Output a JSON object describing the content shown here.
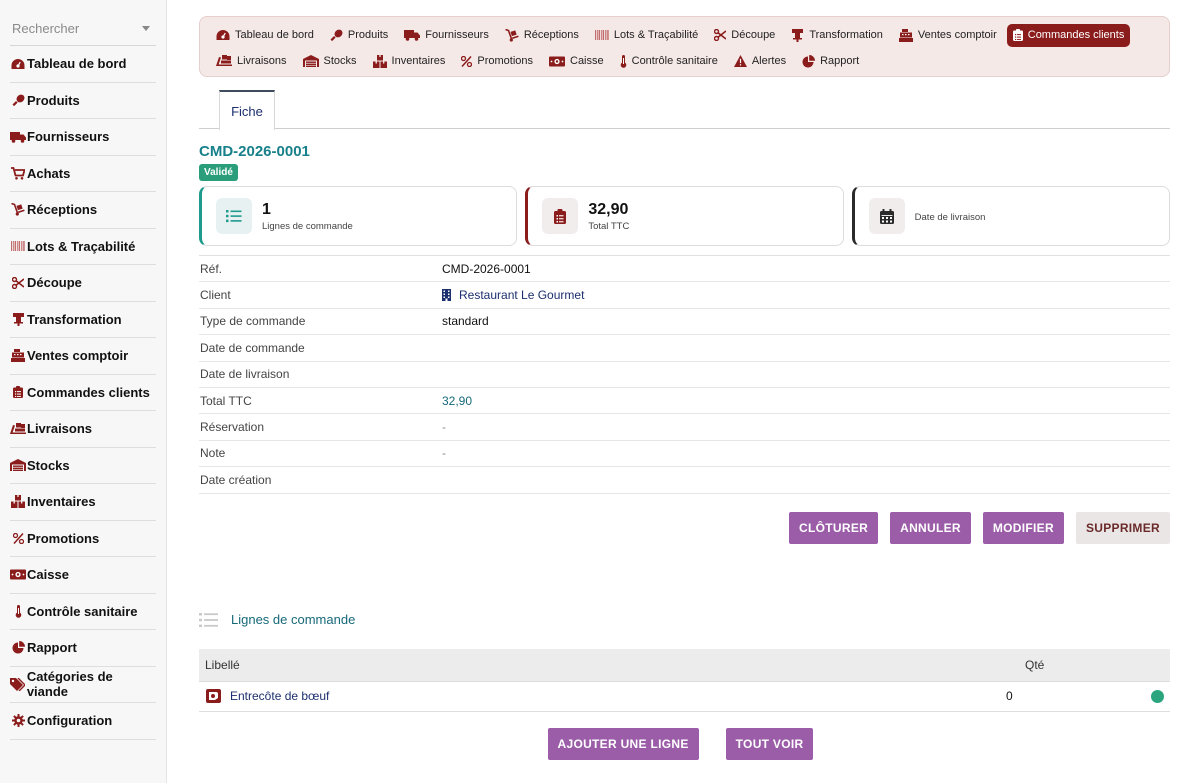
{
  "search": {
    "placeholder": "Rechercher"
  },
  "sidebar": {
    "items": [
      {
        "label": "Tableau de bord",
        "icon": "gauge-icon"
      },
      {
        "label": "Produits",
        "icon": "drumstick-icon"
      },
      {
        "label": "Fournisseurs",
        "icon": "truck-icon"
      },
      {
        "label": "Achats",
        "icon": "cart-icon"
      },
      {
        "label": "Réceptions",
        "icon": "dolly-icon"
      },
      {
        "label": "Lots & Traçabilité",
        "icon": "barcode-icon"
      },
      {
        "label": "Découpe",
        "icon": "scissors-icon"
      },
      {
        "label": "Transformation",
        "icon": "grinder-icon"
      },
      {
        "label": "Ventes comptoir",
        "icon": "cash-register-icon"
      },
      {
        "label": "Commandes clients",
        "icon": "clipboard-list-icon"
      },
      {
        "label": "Livraisons",
        "icon": "truck-ramp-icon"
      },
      {
        "label": "Stocks",
        "icon": "warehouse-icon"
      },
      {
        "label": "Inventaires",
        "icon": "boxes-icon"
      },
      {
        "label": "Promotions",
        "icon": "percent-icon"
      },
      {
        "label": "Caisse",
        "icon": "money-icon"
      },
      {
        "label": "Contrôle sanitaire",
        "icon": "thermometer-icon"
      },
      {
        "label": "Rapport",
        "icon": "pie-chart-icon"
      },
      {
        "label": "Catégories de viande",
        "icon": "tags-icon"
      },
      {
        "label": "Configuration",
        "icon": "gear-icon"
      }
    ]
  },
  "topnav": {
    "row1": [
      {
        "label": "Tableau de bord",
        "icon": "gauge-icon"
      },
      {
        "label": "Produits",
        "icon": "drumstick-icon"
      },
      {
        "label": "Fournisseurs",
        "icon": "truck-icon"
      },
      {
        "label": "Réceptions",
        "icon": "dolly-icon"
      },
      {
        "label": "Lots & Traçabilité",
        "icon": "barcode-icon"
      },
      {
        "label": "Découpe",
        "icon": "scissors-icon"
      },
      {
        "label": "Transformation",
        "icon": "grinder-icon"
      },
      {
        "label": "Ventes comptoir",
        "icon": "cash-register-icon"
      },
      {
        "label": "Commandes clients",
        "icon": "clipboard-list-icon",
        "active": true
      }
    ],
    "row2": [
      {
        "label": "Livraisons",
        "icon": "truck-ramp-icon"
      },
      {
        "label": "Stocks",
        "icon": "warehouse-icon"
      },
      {
        "label": "Inventaires",
        "icon": "boxes-icon"
      },
      {
        "label": "Promotions",
        "icon": "percent-icon"
      },
      {
        "label": "Caisse",
        "icon": "money-icon"
      },
      {
        "label": "Contrôle sanitaire",
        "icon": "thermometer-icon"
      },
      {
        "label": "Alertes",
        "icon": "warning-icon"
      },
      {
        "label": "Rapport",
        "icon": "pie-chart-icon"
      }
    ],
    "active_color": "#8b1c1c"
  },
  "tabs": {
    "fiche": "Fiche"
  },
  "record": {
    "title": "CMD-2026-0001",
    "status": "Validé"
  },
  "cards": {
    "lines_value": "1",
    "lines_label": "Lignes de commande",
    "total_value": "32,90",
    "total_label": "Total TTC",
    "delivery_label": "Date de livraison"
  },
  "details": {
    "ref_label": "Réf.",
    "ref_value": "CMD-2026-0001",
    "client_label": "Client",
    "client_value": "Restaurant Le Gourmet",
    "type_label": "Type de commande",
    "type_value": "standard",
    "order_date_label": "Date de commande",
    "order_date_value": "",
    "delivery_date_label": "Date de livraison",
    "delivery_date_value": "",
    "total_label": "Total TTC",
    "total_value": "32,90",
    "reservation_label": "Réservation",
    "reservation_value": "-",
    "note_label": "Note",
    "note_value": "-",
    "created_label": "Date création",
    "created_value": ""
  },
  "actions": {
    "close": "CLÔTURER",
    "cancel": "ANNULER",
    "edit": "MODIFIER",
    "delete": "SUPPRIMER"
  },
  "lines": {
    "section_title": "Lignes de commande",
    "col_label": "Libellé",
    "col_qty": "Qté",
    "rows": [
      {
        "label": "Entrecôte de bœuf",
        "qty": "0",
        "status_color": "#2aa57e"
      }
    ],
    "add_button": "AJOUTER UNE LIGNE",
    "view_all_button": "TOUT VOIR"
  },
  "colors": {
    "brand": "#8b1c1c",
    "teal": "#17808a",
    "button": "#9b5da8",
    "success": "#2a9d7a"
  }
}
